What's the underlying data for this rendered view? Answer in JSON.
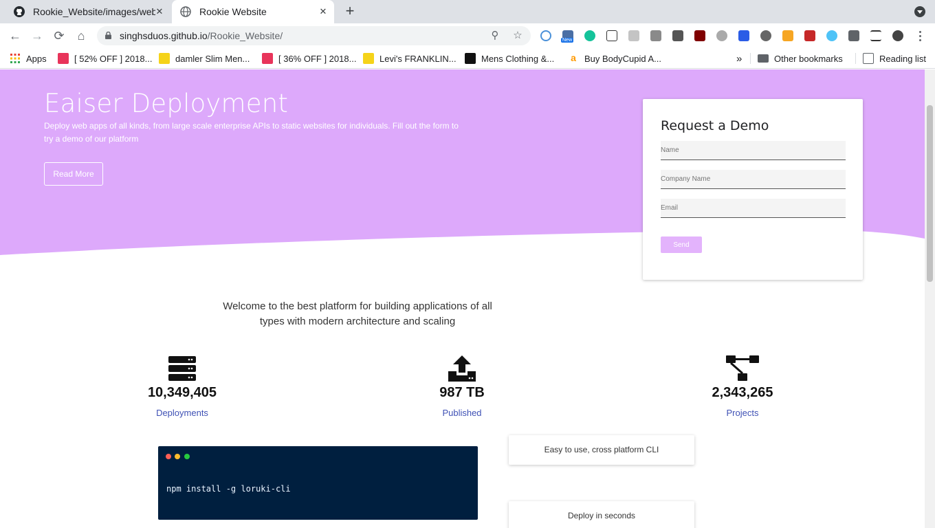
{
  "browser": {
    "tabs": [
      {
        "title": "Rookie_Website/images/web",
        "favicon": "github-icon"
      },
      {
        "title": "Rookie Website",
        "favicon": "globe-icon",
        "active": true
      }
    ],
    "url_host": "singhsduos.github.io",
    "url_path": "/Rookie_Website/",
    "bookmarks": [
      {
        "label": "Apps",
        "icon": "apps-grid-icon"
      },
      {
        "label": "[ 52% OFF ] 2018...",
        "icon": "r-logo-icon",
        "color": "#e8345a"
      },
      {
        "label": "damler Slim Men...",
        "icon": "flipkart-icon",
        "color": "#f5d31a"
      },
      {
        "label": "[ 36% OFF ] 2018...",
        "icon": "r-logo-icon",
        "color": "#e8345a"
      },
      {
        "label": "Levi's FRANKLIN...",
        "icon": "flipkart-icon",
        "color": "#f5d31a"
      },
      {
        "label": "Mens Clothing &...",
        "icon": "myntra-icon",
        "color": "#111111"
      },
      {
        "label": "Buy BodyCupid A...",
        "icon": "amazon-icon",
        "color": "#ff9900"
      }
    ],
    "other_bookmarks": "Other bookmarks",
    "reading_list": "Reading list",
    "overflow": "»",
    "extension_badge": "New"
  },
  "hero": {
    "title": "Eaiser Deployment",
    "subtitle": "Deploy web apps of all kinds, from large scale enterprise APIs to static websites for individuals. Fill out the form to try a demo of our platform",
    "cta": "Read More",
    "bg_color": "#dda9fb"
  },
  "demo_form": {
    "heading": "Request a Demo",
    "name_placeholder": "Name",
    "company_placeholder": "Company Name",
    "email_placeholder": "Email",
    "submit": "Send",
    "submit_color": "#e3b3fc"
  },
  "welcome_text": "Welcome to the best platform for building applications of all types with modern architecture and scaling",
  "stats": [
    {
      "value": "10,349,405",
      "label": "Deployments",
      "icon": "server-stack-icon"
    },
    {
      "value": "987 TB",
      "label": "Published",
      "icon": "upload-icon"
    },
    {
      "value": "2,343,265",
      "label": "Projects",
      "icon": "project-tree-icon"
    }
  ],
  "link_color": "#3f51b5",
  "terminal": {
    "command": "npm install -g loruki-cli",
    "dot_colors": [
      "#ff5f56",
      "#ffbd2e",
      "#27c93f"
    ]
  },
  "features": [
    {
      "text": "Easy to use, cross platform CLI"
    },
    {
      "text": "Deploy in seconds"
    }
  ]
}
